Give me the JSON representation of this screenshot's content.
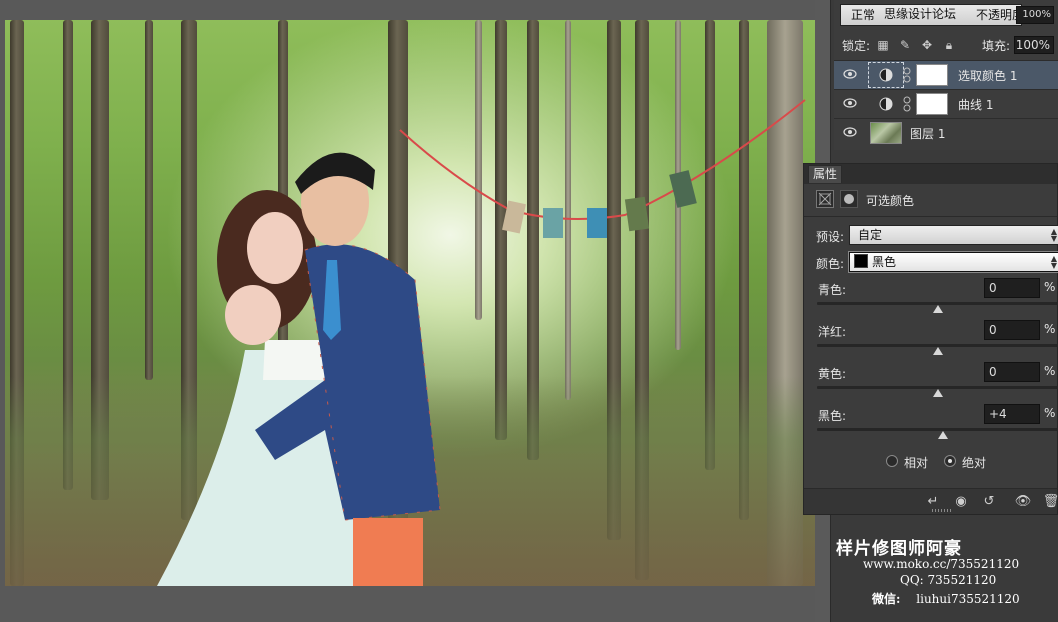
{
  "layers_panel": {
    "blend_mode": "正常",
    "blend_overlay_text": "思缘设计论坛",
    "opacity_label": "不透明度:",
    "opacity_value": "100%",
    "lock_label": "锁定:",
    "fill_label": "填充:",
    "fill_value": "100%",
    "layers": [
      {
        "name": "选取颜色 1",
        "type": "adjustment",
        "selected": true
      },
      {
        "name": "曲线 1",
        "type": "adjustment",
        "selected": false
      },
      {
        "name": "图层 1",
        "type": "image",
        "selected": false
      }
    ]
  },
  "properties_panel": {
    "tab_label": "属性",
    "title": "可选颜色",
    "preset_label": "预设:",
    "preset_value": "自定",
    "color_label": "颜色:",
    "color_value": "黑色",
    "color_swatch": "#000000",
    "sliders": [
      {
        "label": "青色:",
        "value": "0",
        "unit": "%",
        "position": 0.5
      },
      {
        "label": "洋红:",
        "value": "0",
        "unit": "%",
        "position": 0.5
      },
      {
        "label": "黄色:",
        "value": "0",
        "unit": "%",
        "position": 0.5
      },
      {
        "label": "黑色:",
        "value": "+4",
        "unit": "%",
        "position": 0.52
      }
    ],
    "method_relative": "相对",
    "method_absolute": "绝对",
    "method_selected": "absolute"
  },
  "watermark": {
    "title": "样片修图师阿豪",
    "line1": "www.moko.cc/735521120",
    "line2": "QQ: 735521120",
    "line3_label": "微信:",
    "line3_value": "liuhui735521120"
  },
  "colors": {
    "panel_bg": "#3c3c3c",
    "selected_layer": "#4b5868",
    "canvas_bg": "#595959"
  }
}
